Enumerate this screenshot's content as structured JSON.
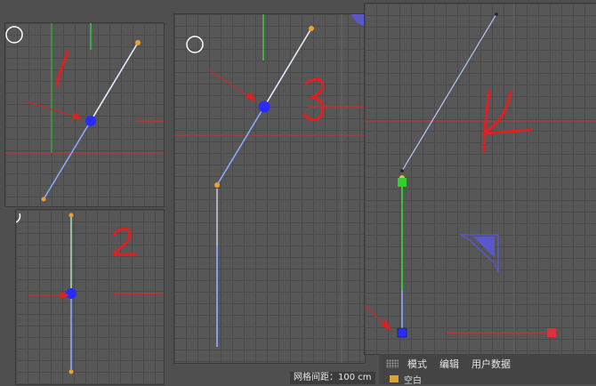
{
  "viewports": [
    {
      "id": "1",
      "annotation_label": "1"
    },
    {
      "id": "2",
      "annotation_label": "2"
    },
    {
      "id": "3",
      "annotation_label": "3"
    },
    {
      "id": "4",
      "annotation_label": "4"
    }
  ],
  "status": {
    "grid_spacing": "网格间距：100 cm"
  },
  "panel": {
    "menu": [
      "模式",
      "编辑",
      "用户数据"
    ],
    "row_label": "空白"
  },
  "colors": {
    "viewport_bg": "#575757",
    "grid": "#4a4a4a",
    "annotation_red": "#e02020",
    "point_blue": "#2a2aff",
    "point_orange": "#f0a030",
    "axis_green": "#38c838",
    "axis_red": "#c83030",
    "spline_white": "#e6ecff",
    "spline_blue": "#8aa8ff",
    "handle_green": "#30d030",
    "handle_red": "#e03040"
  }
}
